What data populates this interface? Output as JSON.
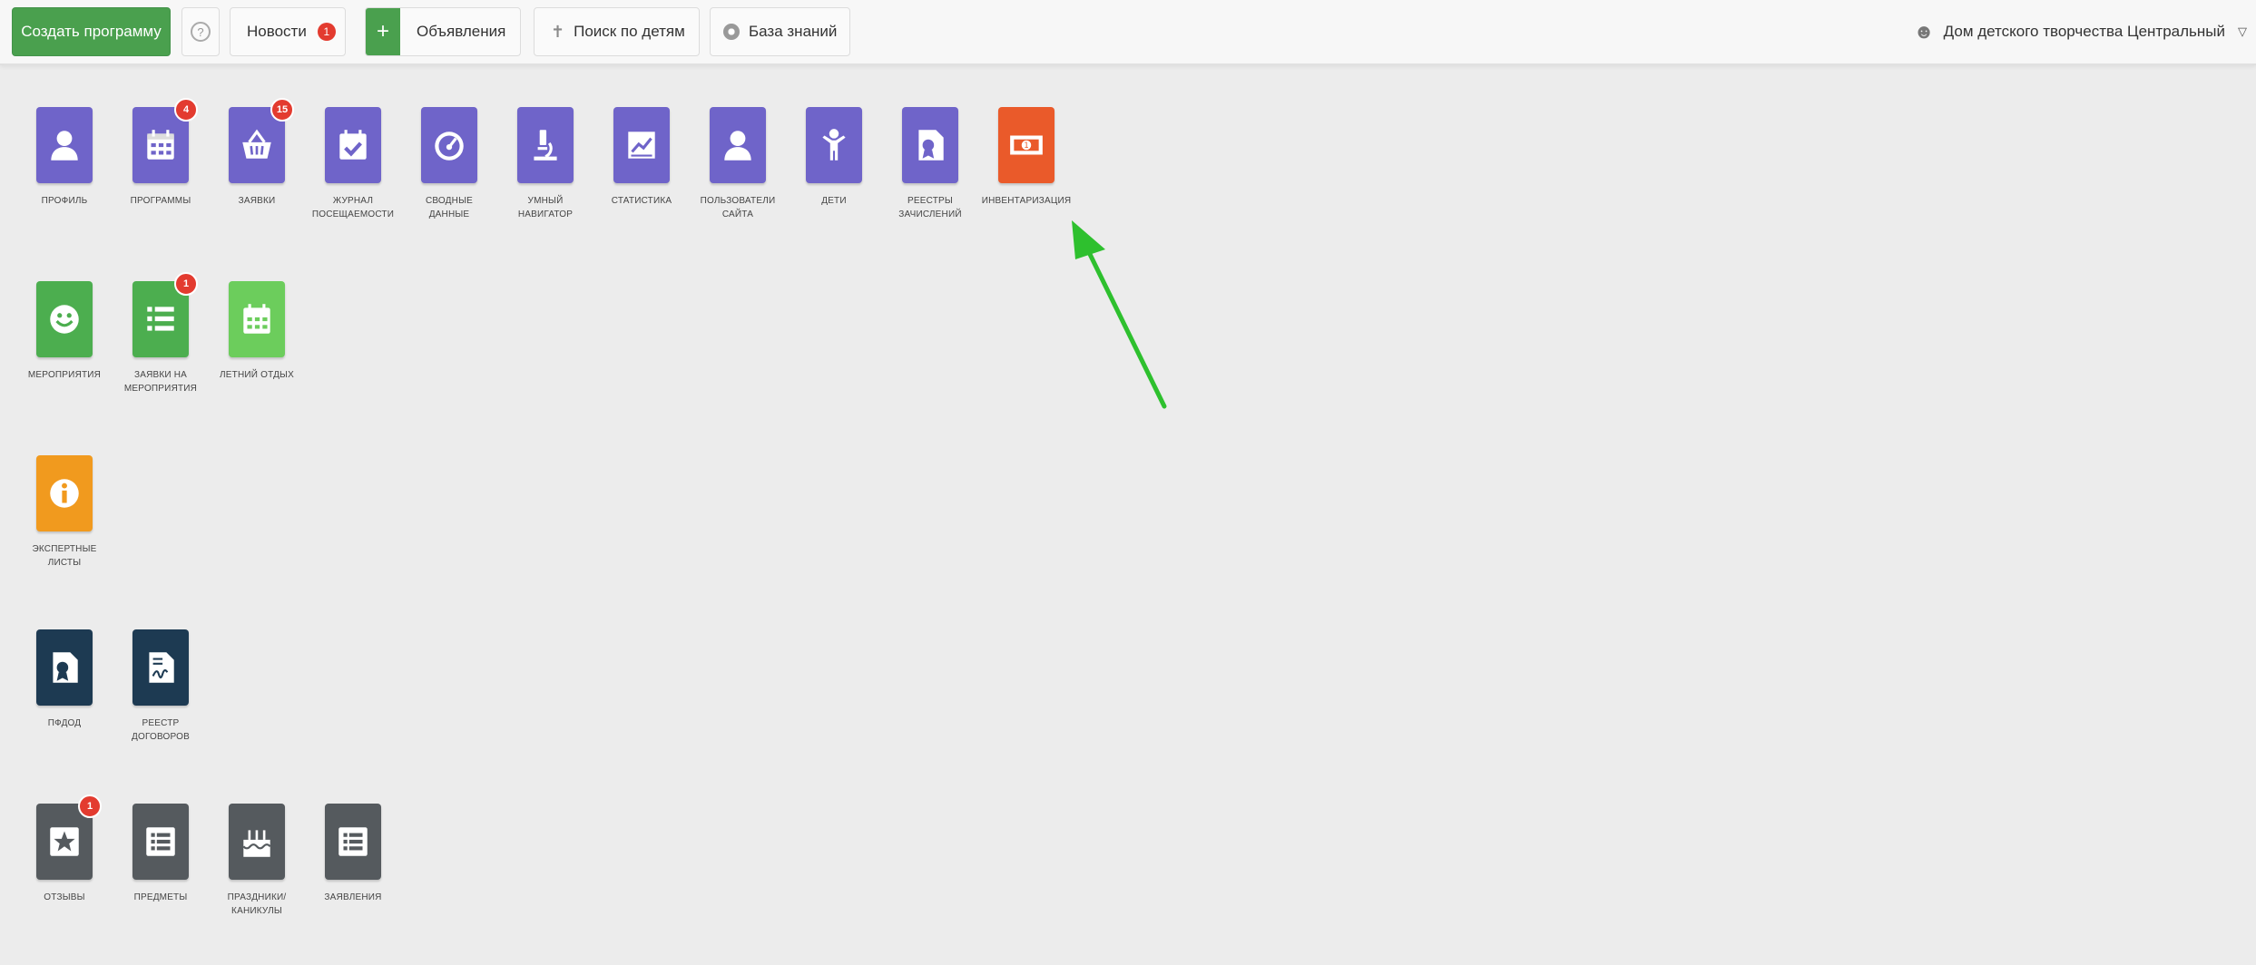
{
  "header": {
    "create_label": "Создать программу",
    "help_symbol": "?",
    "news_label": "Новости",
    "news_badge": "1",
    "announce_label": "Объявления",
    "search_kids_label": "Поиск по детям",
    "knowledge_label": "База знаний",
    "org_label": "Дом детского творчества Центральный"
  },
  "tiles": {
    "profile": {
      "label": "ПРОФИЛЬ"
    },
    "programs": {
      "label": "ПРОГРАММЫ",
      "badge": "4"
    },
    "requests": {
      "label": "ЗАЯВКИ",
      "badge": "15"
    },
    "journal": {
      "label1": "ЖУРНАЛ",
      "label2": "ПОСЕЩАЕМОСТИ"
    },
    "summary": {
      "label1": "СВОДНЫЕ",
      "label2": "ДАННЫЕ"
    },
    "navigator": {
      "label1": "УМНЫЙ",
      "label2": "НАВИГАТОР"
    },
    "statistics": {
      "label": "СТАТИСТИКА"
    },
    "site_users": {
      "label1": "ПОЛЬЗОВАТЕЛИ",
      "label2": "САЙТА"
    },
    "children": {
      "label": "ДЕТИ"
    },
    "registries": {
      "label1": "РЕЕСТРЫ",
      "label2": "ЗАЧИСЛЕНИЙ"
    },
    "inventory": {
      "label": "ИНВЕНТАРИЗАЦИЯ"
    },
    "events": {
      "label": "МЕРОПРИЯТИЯ"
    },
    "event_requests": {
      "label1": "ЗАЯВКИ НА",
      "label2": "МЕРОПРИЯТИЯ",
      "badge": "1"
    },
    "summer": {
      "label": "ЛЕТНИЙ ОТДЫХ"
    },
    "expert": {
      "label1": "ЭКСПЕРТНЫЕ",
      "label2": "ЛИСТЫ"
    },
    "pfdod": {
      "label": "ПФДОД"
    },
    "contracts": {
      "label1": "РЕЕСТР",
      "label2": "ДОГОВОРОВ"
    },
    "reviews": {
      "label": "ОТЗЫВЫ",
      "badge": "1"
    },
    "subjects": {
      "label": "ПРЕДМЕТЫ"
    },
    "holidays": {
      "label1": "ПРАЗДНИКИ/",
      "label2": "КАНИКУЛЫ"
    },
    "statements": {
      "label": "ЗАЯВЛЕНИЯ"
    }
  },
  "colors": {
    "tile_purple": "#6f64c9",
    "tile_orange": "#ea5a2a",
    "tile_green": "#4cae4f",
    "tile_amber": "#f19a1e",
    "tile_navy": "#1d3a52",
    "tile_gray": "#555a5e",
    "annotation_arrow": "#2ec02e"
  }
}
